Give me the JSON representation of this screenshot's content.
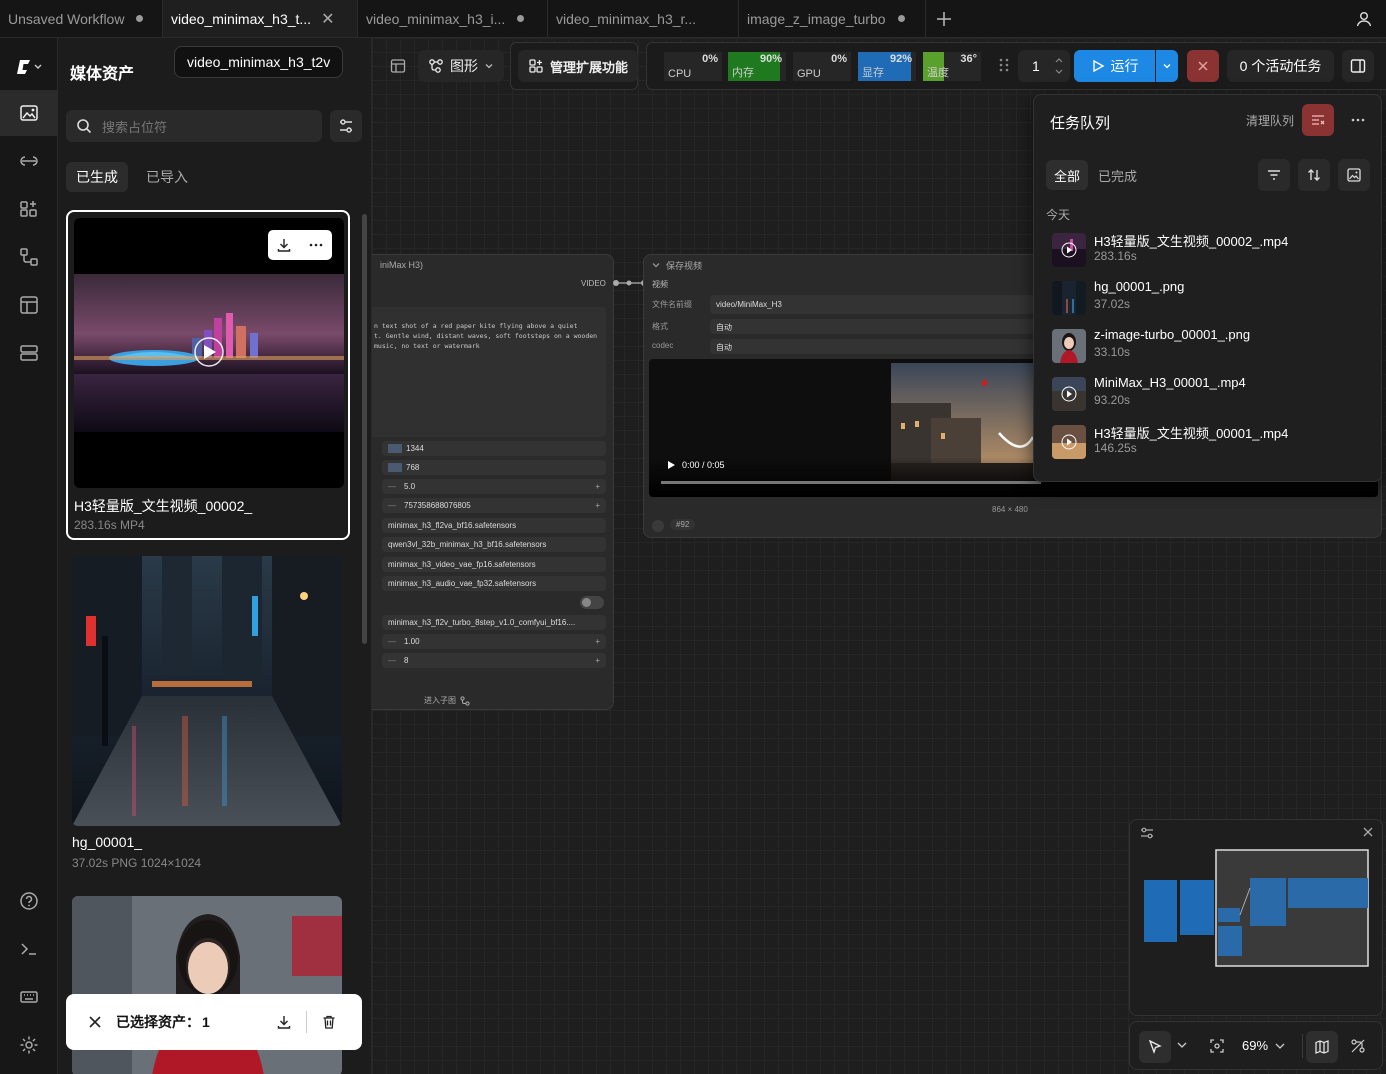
{
  "tabs": [
    {
      "label": "Unsaved Workflow",
      "modified": true
    },
    {
      "label": "video_minimax_h3_t...",
      "active": true
    },
    {
      "label": "video_minimax_h3_i...",
      "modified": true
    },
    {
      "label": "video_minimax_h3_r..."
    },
    {
      "label": "image_z_image_turbo",
      "modified": true
    }
  ],
  "assets": {
    "title": "媒体资产",
    "tooltip": "video_minimax_h3_t2v",
    "search_placeholder": "搜索占位符",
    "tab_generated": "已生成",
    "tab_imported": "已导入",
    "items": [
      {
        "name": "H3轻量版_文生视频_00002_",
        "meta": "283.16s  MP4"
      },
      {
        "name": "hg_00001_",
        "meta": "37.02s  PNG 1024×1024"
      },
      {
        "name": "",
        "meta": ""
      }
    ],
    "selection_label": "已选择资产：",
    "selection_count": "1"
  },
  "toolbar": {
    "graph_label": "图形",
    "extensions_label": "管理扩展功能",
    "run_count": "1",
    "run_label": "运行",
    "active_tasks": "0 个活动任务"
  },
  "meters": [
    {
      "name": "CPU",
      "pct": "0%",
      "fill": 0,
      "color": "#2a2a2a"
    },
    {
      "name": "内存",
      "pct": "90%",
      "fill": 90,
      "color": "#1f7a1f"
    },
    {
      "name": "GPU",
      "pct": "0%",
      "fill": 0,
      "color": "#2a2a2a"
    },
    {
      "name": "显存",
      "pct": "92%",
      "fill": 92,
      "color": "#1f6bb5"
    },
    {
      "name": "温度",
      "pct": "36°",
      "fill": 36,
      "color": "#5aa02c"
    }
  ],
  "node_left": {
    "title": "iniMax H3)",
    "output": "VIDEO",
    "prompt": "n text shot of a red paper kite flying above a quiet\nt. Gentle wind, distant waves, soft footsteps on a wooden\nmusic, no text or watermark",
    "width": "1344",
    "height": "768",
    "length": "5.0",
    "seed": "757358688076805",
    "model": "minimax_h3_fl2va_bf16.safetensors",
    "text_encoder": "qwen3vl_32b_minimax_h3_bf16.safetensors",
    "video_vae": "minimax_h3_video_vae_fp16.safetensors",
    "audio_vae": "minimax_h3_audio_vae_fp32.safetensors",
    "lora": "minimax_h3_fl2v_turbo_8step_v1.0_comfyui_bf16....",
    "strength": "1.00",
    "steps": "8",
    "enter_subgraph": "进入子图"
  },
  "node_save": {
    "title": "保存视频",
    "input": "视频",
    "prefix_label": "文件名前缀",
    "prefix_value": "video/MiniMax_H3",
    "format_label": "格式",
    "format_value": "自动",
    "codec_label": "codec",
    "codec_value": "自动",
    "time": "0:00 / 0:05",
    "dims": "864 × 480",
    "node_id": "#92"
  },
  "queue": {
    "title": "任务队列",
    "clear_label": "清理队列",
    "tab_all": "全部",
    "tab_done": "已完成",
    "day": "今天",
    "items": [
      {
        "name": "H3轻量版_文生视频_00002_.mp4",
        "time": "283.16s",
        "video": true
      },
      {
        "name": "hg_00001_.png",
        "time": "37.02s",
        "video": false
      },
      {
        "name": "z-image-turbo_00001_.png",
        "time": "33.10s",
        "video": false
      },
      {
        "name": "MiniMax_H3_00001_.mp4",
        "time": "93.20s",
        "video": true
      },
      {
        "name": "H3轻量版_文生视频_00001_.mp4",
        "time": "146.25s",
        "video": true
      }
    ]
  },
  "zoom": "69%"
}
